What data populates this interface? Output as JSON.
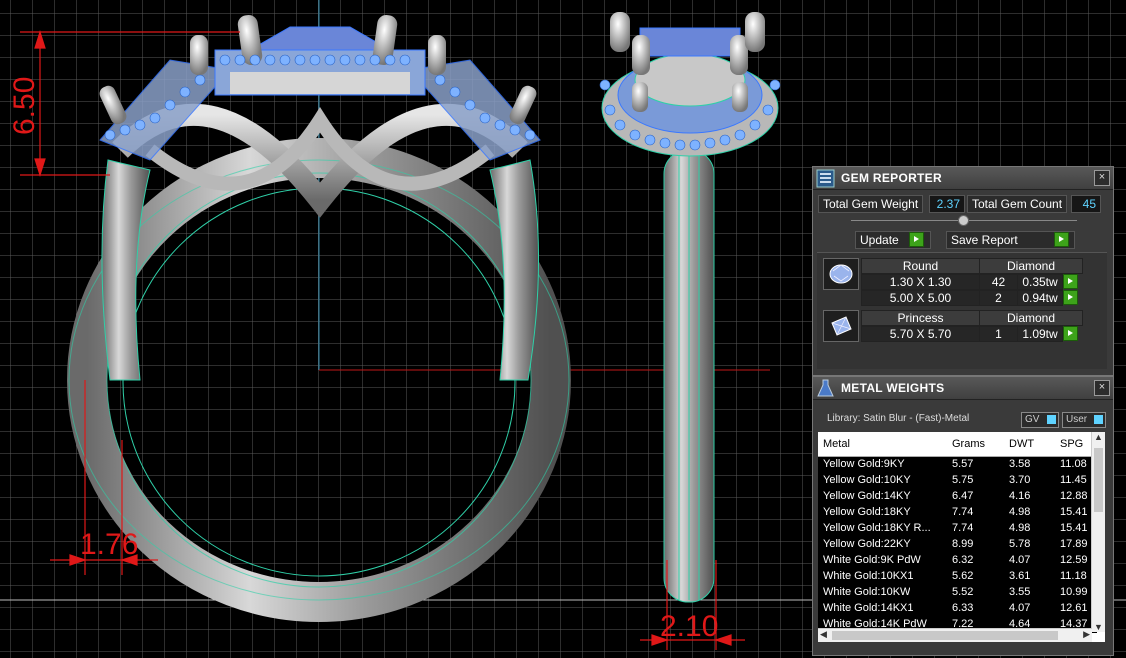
{
  "dimensions": {
    "height_label": "6.50",
    "shank_label": "1.76",
    "side_label": "2.10"
  },
  "colors": {
    "dimension": "#e01818",
    "grid": "#5a5a5a",
    "wire": "#2fd0a8",
    "gem": "#5aa0ff",
    "value_text": "#5fd3ff",
    "go_button": "#3da31a"
  },
  "gem_reporter": {
    "title": "GEM REPORTER",
    "close": "×",
    "total_weight_label": "Total Gem Weight",
    "total_weight_value": "2.37",
    "total_count_label": "Total Gem Count",
    "total_count_value": "45",
    "update_label": "Update",
    "save_label": "Save Report",
    "groups": [
      {
        "icon": "round-gem-icon",
        "shape": "Round",
        "material": "Diamond",
        "rows": [
          {
            "size": "1.30 X 1.30",
            "count": "42",
            "weight": "0.35tw"
          },
          {
            "size": "5.00 X 5.00",
            "count": "2",
            "weight": "0.94tw"
          }
        ]
      },
      {
        "icon": "princess-gem-icon",
        "shape": "Princess",
        "material": "Diamond",
        "rows": [
          {
            "size": "5.70 X 5.70",
            "count": "1",
            "weight": "1.09tw"
          }
        ]
      }
    ]
  },
  "metal_weights": {
    "title": "METAL WEIGHTS",
    "close": "×",
    "library": "Library: Satin Blur - (Fast)-Metal",
    "gv_label": "GV",
    "user_label": "User",
    "columns": [
      "Metal",
      "Grams",
      "DWT",
      "SPG"
    ],
    "rows": [
      {
        "metal": "Yellow Gold:9KY",
        "grams": "5.57",
        "dwt": "3.58",
        "spg": "11.08"
      },
      {
        "metal": "Yellow Gold:10KY",
        "grams": "5.75",
        "dwt": "3.70",
        "spg": "11.45"
      },
      {
        "metal": "Yellow Gold:14KY",
        "grams": "6.47",
        "dwt": "4.16",
        "spg": "12.88"
      },
      {
        "metal": "Yellow Gold:18KY",
        "grams": "7.74",
        "dwt": "4.98",
        "spg": "15.41"
      },
      {
        "metal": "Yellow Gold:18KY R...",
        "grams": "7.74",
        "dwt": "4.98",
        "spg": "15.41"
      },
      {
        "metal": "Yellow Gold:22KY",
        "grams": "8.99",
        "dwt": "5.78",
        "spg": "17.89"
      },
      {
        "metal": "White Gold:9K PdW",
        "grams": "6.32",
        "dwt": "4.07",
        "spg": "12.59"
      },
      {
        "metal": "White Gold:10KX1",
        "grams": "5.62",
        "dwt": "3.61",
        "spg": "11.18"
      },
      {
        "metal": "White Gold:10KW",
        "grams": "5.52",
        "dwt": "3.55",
        "spg": "10.99"
      },
      {
        "metal": "White Gold:14KX1",
        "grams": "6.33",
        "dwt": "4.07",
        "spg": "12.61"
      },
      {
        "metal": "White Gold:14K PdW",
        "grams": "7.22",
        "dwt": "4.64",
        "spg": "14.37"
      }
    ]
  }
}
